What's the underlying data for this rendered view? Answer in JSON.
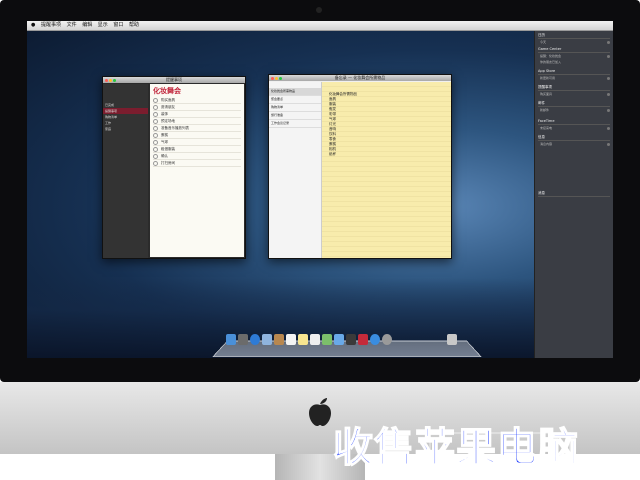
{
  "menubar": {
    "apple_label": "",
    "app_name": "提醒事项",
    "items": [
      "文件",
      "编辑",
      "显示",
      "窗口",
      "帮助"
    ]
  },
  "reminders": {
    "window_title": "提醒事项",
    "sidebar_lists": [
      "已完成",
      "提醒事项",
      "购物清单",
      "工作",
      "家庭"
    ],
    "selected_index": 1,
    "heading": "化妆舞会",
    "items": [
      "购买面具",
      "邀请朋友",
      "装饰",
      "预定场地",
      "准备音乐播放列表",
      "蛋糕",
      "气球",
      "租借服装",
      "确认",
      "打扫房间"
    ]
  },
  "notes": {
    "window_title": "备忘录 — 化妆舞会所需物品",
    "list": [
      "化妆舞会所需物品",
      "聚会要点",
      "购物清单",
      "旅行准备",
      "工作会议记录"
    ],
    "selected_index": 0,
    "lines": [
      "化妆舞会所需物品",
      "面具",
      "服装",
      "假发",
      "彩带",
      "气球",
      "灯光",
      "音响",
      "饮料",
      "零食",
      "蛋糕",
      "相机",
      "纸杯"
    ]
  },
  "notification_center": {
    "headers": [
      "日历",
      "Game Center",
      "App Store",
      "提醒事项",
      "邮件",
      "FaceTime",
      "信息",
      "消息"
    ],
    "rows": [
      "今天",
      "提醒：化妆舞会",
      "你的朋友已加入",
      "新更新可用",
      "购买面具",
      "新邮件",
      "未接来电",
      "消息内容"
    ]
  },
  "dock": {
    "icons": [
      "finder",
      "launchpad",
      "safari",
      "mail",
      "contacts",
      "calendar",
      "notes",
      "reminders",
      "maps",
      "messages",
      "facetime",
      "itunes",
      "app-store",
      "preferences",
      "trash"
    ]
  },
  "caption": {
    "text": "收售苹果电脑"
  },
  "colors": {
    "caption": "#0b2cff",
    "reminders_accent": "#c0243a",
    "notes_paper": "#f8ecac"
  }
}
